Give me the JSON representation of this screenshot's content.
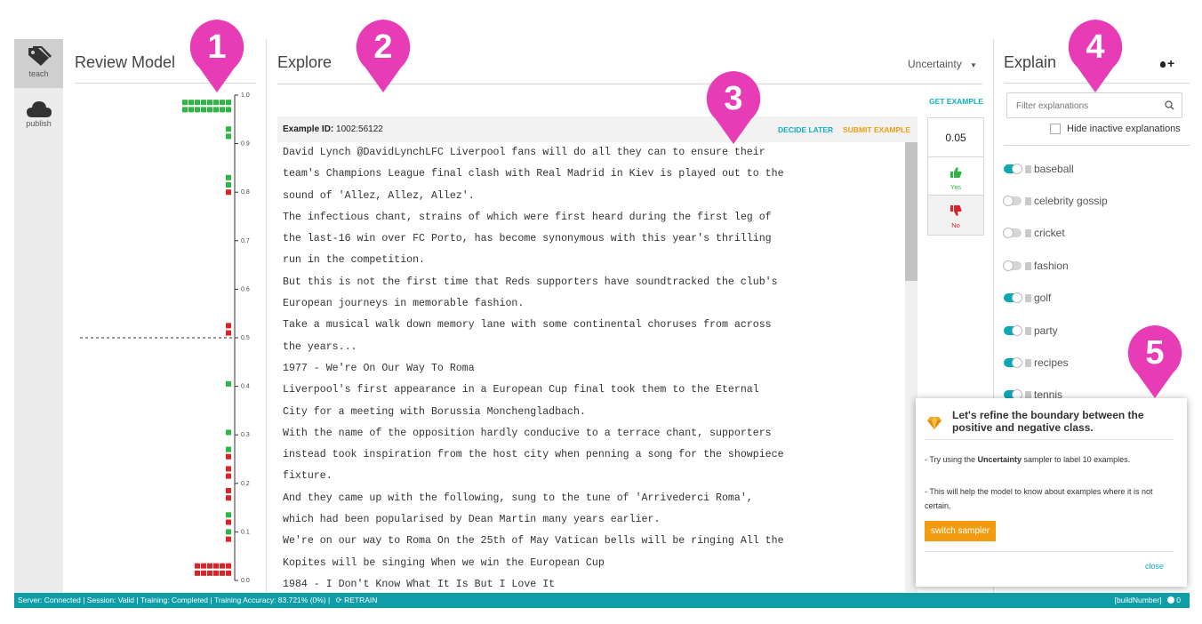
{
  "nav": {
    "teach_label": "teach",
    "publish_label": "publish"
  },
  "review": {
    "title": "Review Model",
    "ticks": [
      "1.0",
      "0.9",
      "0.8",
      "0.7",
      "0.6",
      "0.5",
      "0.4",
      "0.3",
      "0.2",
      "0.1",
      "0.0"
    ]
  },
  "explore": {
    "title": "Explore",
    "sampler": "Uncertainty",
    "get_example": "GET EXAMPLE",
    "example_id_label": "Example ID:",
    "example_id": "1002:56122",
    "decide_later": "DECIDE LATER",
    "submit_example": "SUBMIT EXAMPLE",
    "lines": [
      "David Lynch @DavidLynchLFC Liverpool fans will do all they can to ensure their",
      "team's Champions League final clash with Real Madrid in Kiev is played out to the",
      "sound of 'Allez, Allez, Allez'.",
      "The infectious chant, strains of which were first heard during the first leg of",
      "the last-16 win over FC Porto, has become synonymous with this year's thrilling",
      "run in the competition.",
      "But this is not the first time that Reds supporters have soundtracked the club's",
      "European journeys in memorable fashion.",
      "Take a musical walk down memory lane with some continental choruses from across",
      "the years...",
      "1977 - We're On Our Way To Roma",
      "Liverpool's first appearance in a European Cup final took them to the Eternal",
      "City for a meeting with Borussia Monchengladbach.",
      "With the name of the opposition hardly conducive to a terrace chant, supporters",
      "instead took inspiration from the host city when penning a song for the showpiece",
      "fixture.",
      "And they came up with the following, sung to the tune of 'Arrivederci Roma',",
      "which had been popularised by Dean Martin many years earlier.",
      "We're on our way to Roma On the 25th of May Vatican bells will be ringing All the",
      "Kopites will be singing When we win the European Cup",
      "1984 - I Don't Know What It Is But I Love It"
    ],
    "score": "0.05",
    "yes_label": "Yes",
    "no_label": "No"
  },
  "explain": {
    "title": "Explain",
    "filter_placeholder": "Filter explanations",
    "hide_inactive_label": "Hide inactive explanations",
    "items": [
      {
        "label": "baseball",
        "on": true
      },
      {
        "label": "celebrity gossip",
        "on": false
      },
      {
        "label": "cricket",
        "on": false
      },
      {
        "label": "fashion",
        "on": false
      },
      {
        "label": "golf",
        "on": true
      },
      {
        "label": "party",
        "on": true
      },
      {
        "label": "recipes",
        "on": true
      },
      {
        "label": "tennis",
        "on": true
      }
    ]
  },
  "popup": {
    "title": "Let's refine the boundary between the positive and negative class.",
    "tip1_pre": "- Try using the ",
    "tip1_bold": "Uncertainty",
    "tip1_post": " sampler to label 10 examples.",
    "tip2": "- This will help the model to know about examples where it is not certain.",
    "switch_button": "switch sampler",
    "close": "close"
  },
  "pins": [
    "1",
    "2",
    "3",
    "4",
    "5"
  ],
  "status": {
    "text": "Server: Connected | Session: Valid | Training: Completed | Training Accuracy: 83.721% (0%) |",
    "retrain": "RETRAIN",
    "build": "[buildNumber]",
    "count": "0"
  },
  "colors": {
    "accent": "#0f9ea8",
    "pin": "#e83bb6",
    "positive": "#2db742",
    "negative": "#d9252a",
    "orange": "#f39c12"
  }
}
